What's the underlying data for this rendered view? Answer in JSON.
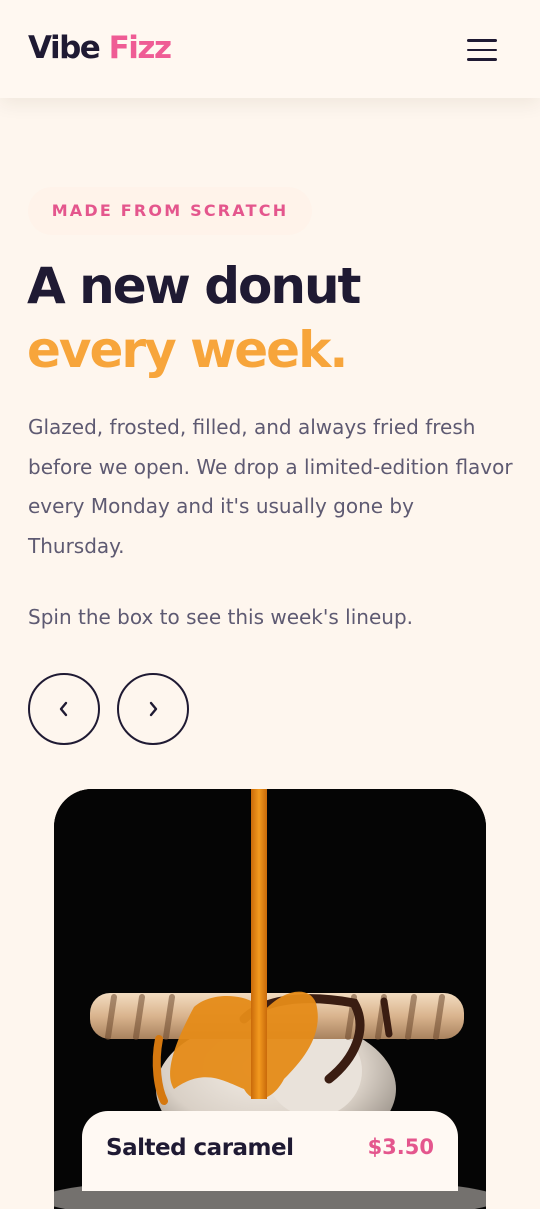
{
  "header": {
    "logo_part1": "Vibe",
    "logo_part2": "Fizz",
    "menu_icon": "hamburger-menu-icon"
  },
  "hero": {
    "badge": "MADE FROM SCRATCH",
    "title_line1": "A new donut",
    "title_line2": "every week.",
    "body": "Glazed, frosted, filled, and always fried fresh before we open. We drop a limited-edition flavor every Monday and it's usually gone by Thursday.",
    "subtext": "Spin the box to see this week's lineup."
  },
  "carousel": {
    "prev_icon": "chevron-left-icon",
    "next_icon": "chevron-right-icon",
    "card": {
      "image": "caramel-drizzle-dessert-photo",
      "name": "Salted caramel",
      "price": "$3.50"
    }
  },
  "colors": {
    "background": "#fef6ee",
    "dark": "#1f1a33",
    "pink": "#ef5c95",
    "orange": "#f7a53b",
    "muted_text": "#5e5a72"
  }
}
